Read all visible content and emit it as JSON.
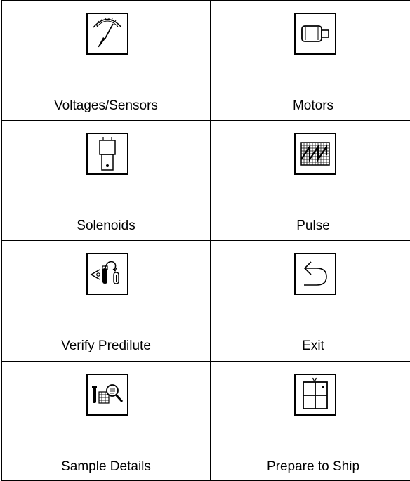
{
  "menu": {
    "items": [
      {
        "label": "Voltages/Sensors",
        "icon": "gauge-icon"
      },
      {
        "label": "Motors",
        "icon": "motor-icon"
      },
      {
        "label": "Solenoids",
        "icon": "solenoid-icon"
      },
      {
        "label": "Pulse",
        "icon": "pulse-grid-icon"
      },
      {
        "label": "Verify Predilute",
        "icon": "predilute-icon"
      },
      {
        "label": "Exit",
        "icon": "exit-arrow-icon"
      },
      {
        "label": "Sample Details",
        "icon": "sample-magnifier-icon"
      },
      {
        "label": "Prepare to Ship",
        "icon": "ship-box-icon"
      }
    ]
  }
}
